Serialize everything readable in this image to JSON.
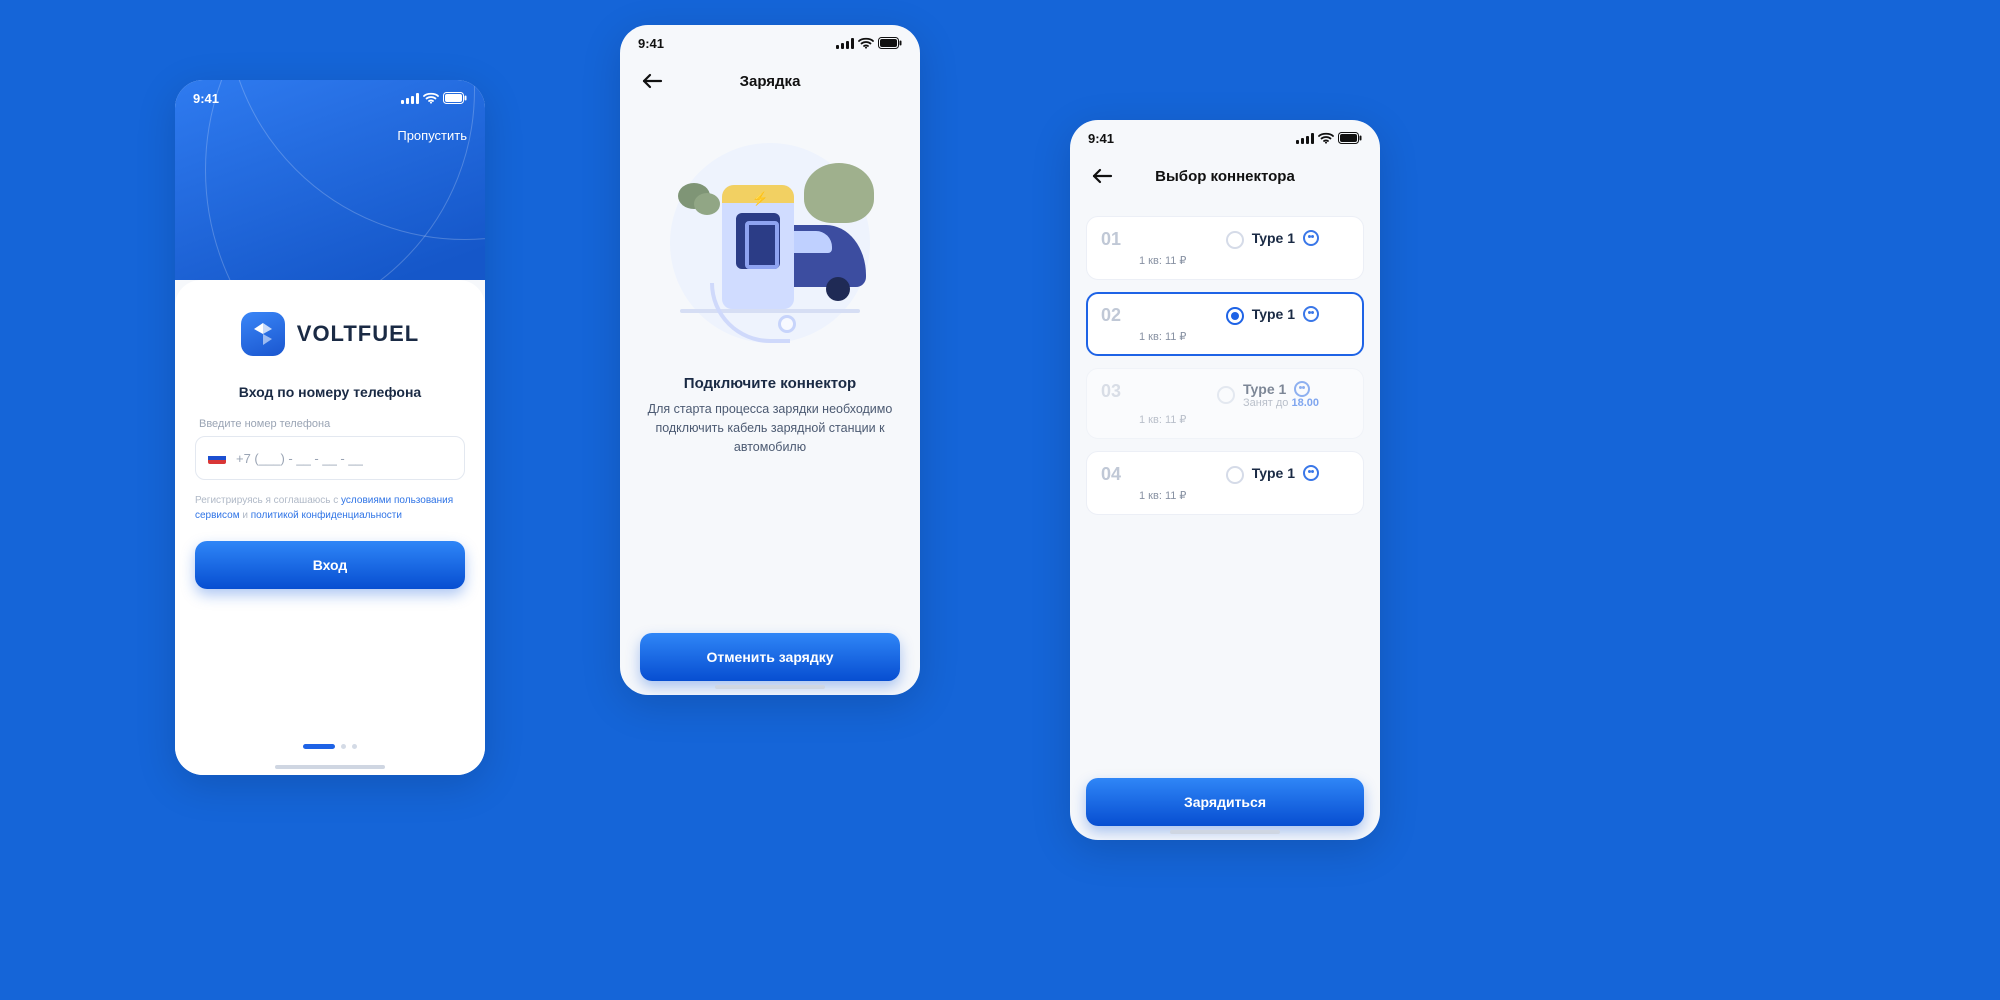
{
  "status": {
    "time": "9:41"
  },
  "screen1": {
    "skip": "Пропустить",
    "brand": "VOLTFUEL",
    "subtitle": "Вход по номеру телефона",
    "phone_label": "Введите номер телефона",
    "phone_mask": "+7 (___) - __ - __ - __",
    "consent_pre": "Регистрируясь я соглашаюсь с ",
    "consent_link1": "условиями пользования сервисом",
    "consent_mid": " и ",
    "consent_link2": "политикой конфиденциальности",
    "cta": "Вход"
  },
  "screen2": {
    "header": "Зарядка",
    "title": "Подключите коннектор",
    "desc": "Для старта процесса зарядки необходимо подключить кабель зарядной станции к автомобилю",
    "cta": "Отменить зарядку"
  },
  "screen3": {
    "header": "Выбор коннектора",
    "cta": "Зарядиться",
    "items": [
      {
        "num": "01",
        "name": "Type 1",
        "sub": "1 кв:  11 ₽",
        "state": "idle"
      },
      {
        "num": "02",
        "name": "Type 1",
        "sub": "1 кв:  11 ₽",
        "state": "selected"
      },
      {
        "num": "03",
        "name": "Type 1",
        "sub": "1 кв:  11 ₽",
        "state": "disabled",
        "busy_label": "Занят до",
        "busy_time": "18.00"
      },
      {
        "num": "04",
        "name": "Type 1",
        "sub": "1 кв:  11 ₽",
        "state": "idle"
      }
    ]
  }
}
